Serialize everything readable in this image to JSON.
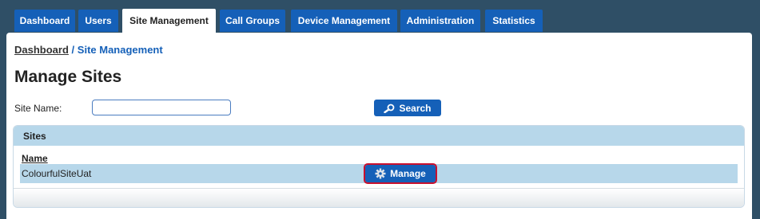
{
  "nav": {
    "tabs": [
      {
        "label": "Dashboard",
        "active": false
      },
      {
        "label": "Users",
        "active": false
      },
      {
        "label": "Site Management",
        "active": true
      },
      {
        "label": "Call Groups",
        "active": false
      },
      {
        "label": "Device Management",
        "active": false
      },
      {
        "label": "Administration",
        "active": false
      },
      {
        "label": "Statistics",
        "active": false
      }
    ]
  },
  "breadcrumb": {
    "root": "Dashboard",
    "separator": "/",
    "current": "Site Management"
  },
  "page": {
    "title": "Manage Sites"
  },
  "search": {
    "label": "Site Name:",
    "value": "",
    "placeholder": "",
    "button_label": "Search",
    "button_icon": "search-icon"
  },
  "sites": {
    "header": "Sites",
    "column_name": "Name",
    "rows": [
      {
        "name": "ColourfulSiteUat",
        "action_label": "Manage",
        "action_icon": "gear-icon"
      }
    ]
  },
  "colors": {
    "background": "#2f4f66",
    "accent": "#1560b8",
    "table_header": "#b7d7ea",
    "highlight_outline": "#c8102e"
  }
}
